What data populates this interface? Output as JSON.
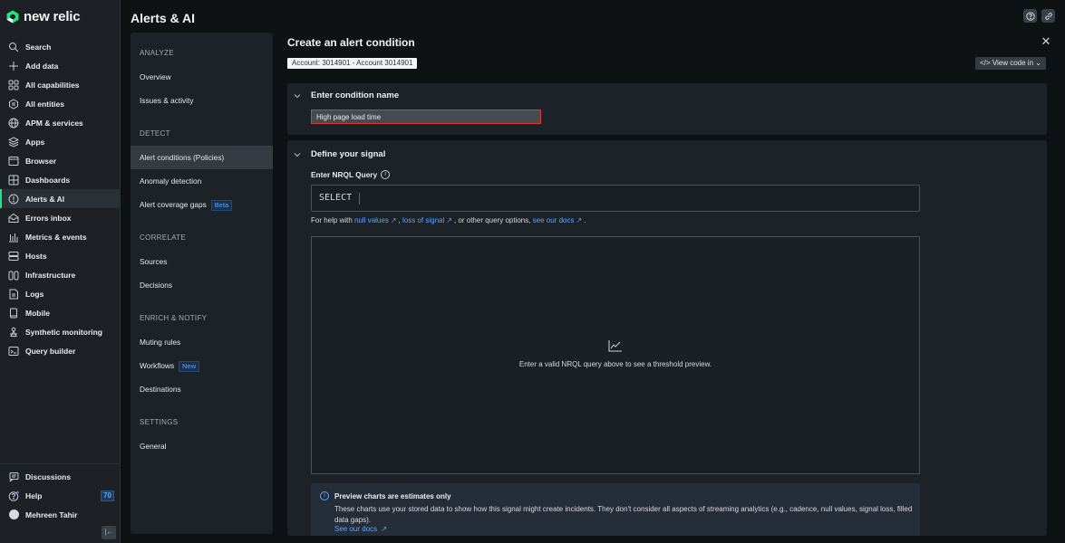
{
  "brand": {
    "name": "new relic",
    "accent": "#1ce783"
  },
  "global_nav": {
    "items": [
      {
        "label": "Search",
        "icon": "search-icon"
      },
      {
        "label": "Add data",
        "icon": "plus-icon"
      },
      {
        "label": "All capabilities",
        "icon": "grid-icon"
      },
      {
        "label": "All entities",
        "icon": "entities-icon"
      },
      {
        "label": "APM & services",
        "icon": "globe-icon"
      },
      {
        "label": "Apps",
        "icon": "layers-icon"
      },
      {
        "label": "Browser",
        "icon": "browser-window-icon"
      },
      {
        "label": "Dashboards",
        "icon": "dashboard-icon"
      },
      {
        "label": "Alerts & AI",
        "icon": "alert-circle-icon",
        "active": true
      },
      {
        "label": "Errors inbox",
        "icon": "inbox-icon"
      },
      {
        "label": "Metrics & events",
        "icon": "bar-chart-icon"
      },
      {
        "label": "Hosts",
        "icon": "server-icon"
      },
      {
        "label": "Infrastructure",
        "icon": "infrastructure-icon"
      },
      {
        "label": "Logs",
        "icon": "log-file-icon"
      },
      {
        "label": "Mobile",
        "icon": "mobile-icon"
      },
      {
        "label": "Synthetic monitoring",
        "icon": "synthetic-icon"
      },
      {
        "label": "Query builder",
        "icon": "terminal-icon"
      }
    ],
    "bottom": {
      "discussions": "Discussions",
      "help": "Help",
      "help_badge": "70",
      "user": "Mehreen Tahir"
    }
  },
  "app": {
    "title": "Alerts & AI"
  },
  "secondary_nav": {
    "sections": [
      {
        "title": "ANALYZE",
        "items": [
          {
            "label": "Overview"
          },
          {
            "label": "Issues & activity"
          }
        ]
      },
      {
        "title": "DETECT",
        "items": [
          {
            "label": "Alert conditions (Policies)",
            "active": true
          },
          {
            "label": "Anomaly detection"
          },
          {
            "label": "Alert coverage gaps",
            "tag": "Beta"
          }
        ]
      },
      {
        "title": "CORRELATE",
        "items": [
          {
            "label": "Sources"
          },
          {
            "label": "Decisions"
          }
        ]
      },
      {
        "title": "ENRICH & NOTIFY",
        "items": [
          {
            "label": "Muting rules"
          },
          {
            "label": "Workflows",
            "tag": "New"
          },
          {
            "label": "Destinations"
          }
        ]
      },
      {
        "title": "SETTINGS",
        "items": [
          {
            "label": "General"
          }
        ]
      }
    ]
  },
  "main": {
    "title": "Create an alert condition",
    "account": "Account: 3014901 - Account 3014901",
    "view_code": "View code in",
    "condition_name": {
      "heading": "Enter condition name",
      "value": "High page load time"
    },
    "signal": {
      "heading": "Define your signal",
      "nrql_label": "Enter NRQL Query",
      "nrql_value": "SELECT",
      "help_prefix": "For help with",
      "link_null_values": "null values",
      "sep1": ",",
      "link_loss_of_signal": "loss of signal",
      "mid_text": ", or other query options,",
      "link_docs": "see our docs",
      "suffix": ".",
      "preview_message": "Enter a valid NRQL query above to see a threshold preview."
    },
    "notice": {
      "title": "Preview charts are estimates only",
      "body": "These charts use your stored data to show how this signal might create incidents. They don't consider all aspects of streaming analytics (e.g., cadence, null values, signal loss, filled data gaps).",
      "link": "See our docs"
    }
  }
}
